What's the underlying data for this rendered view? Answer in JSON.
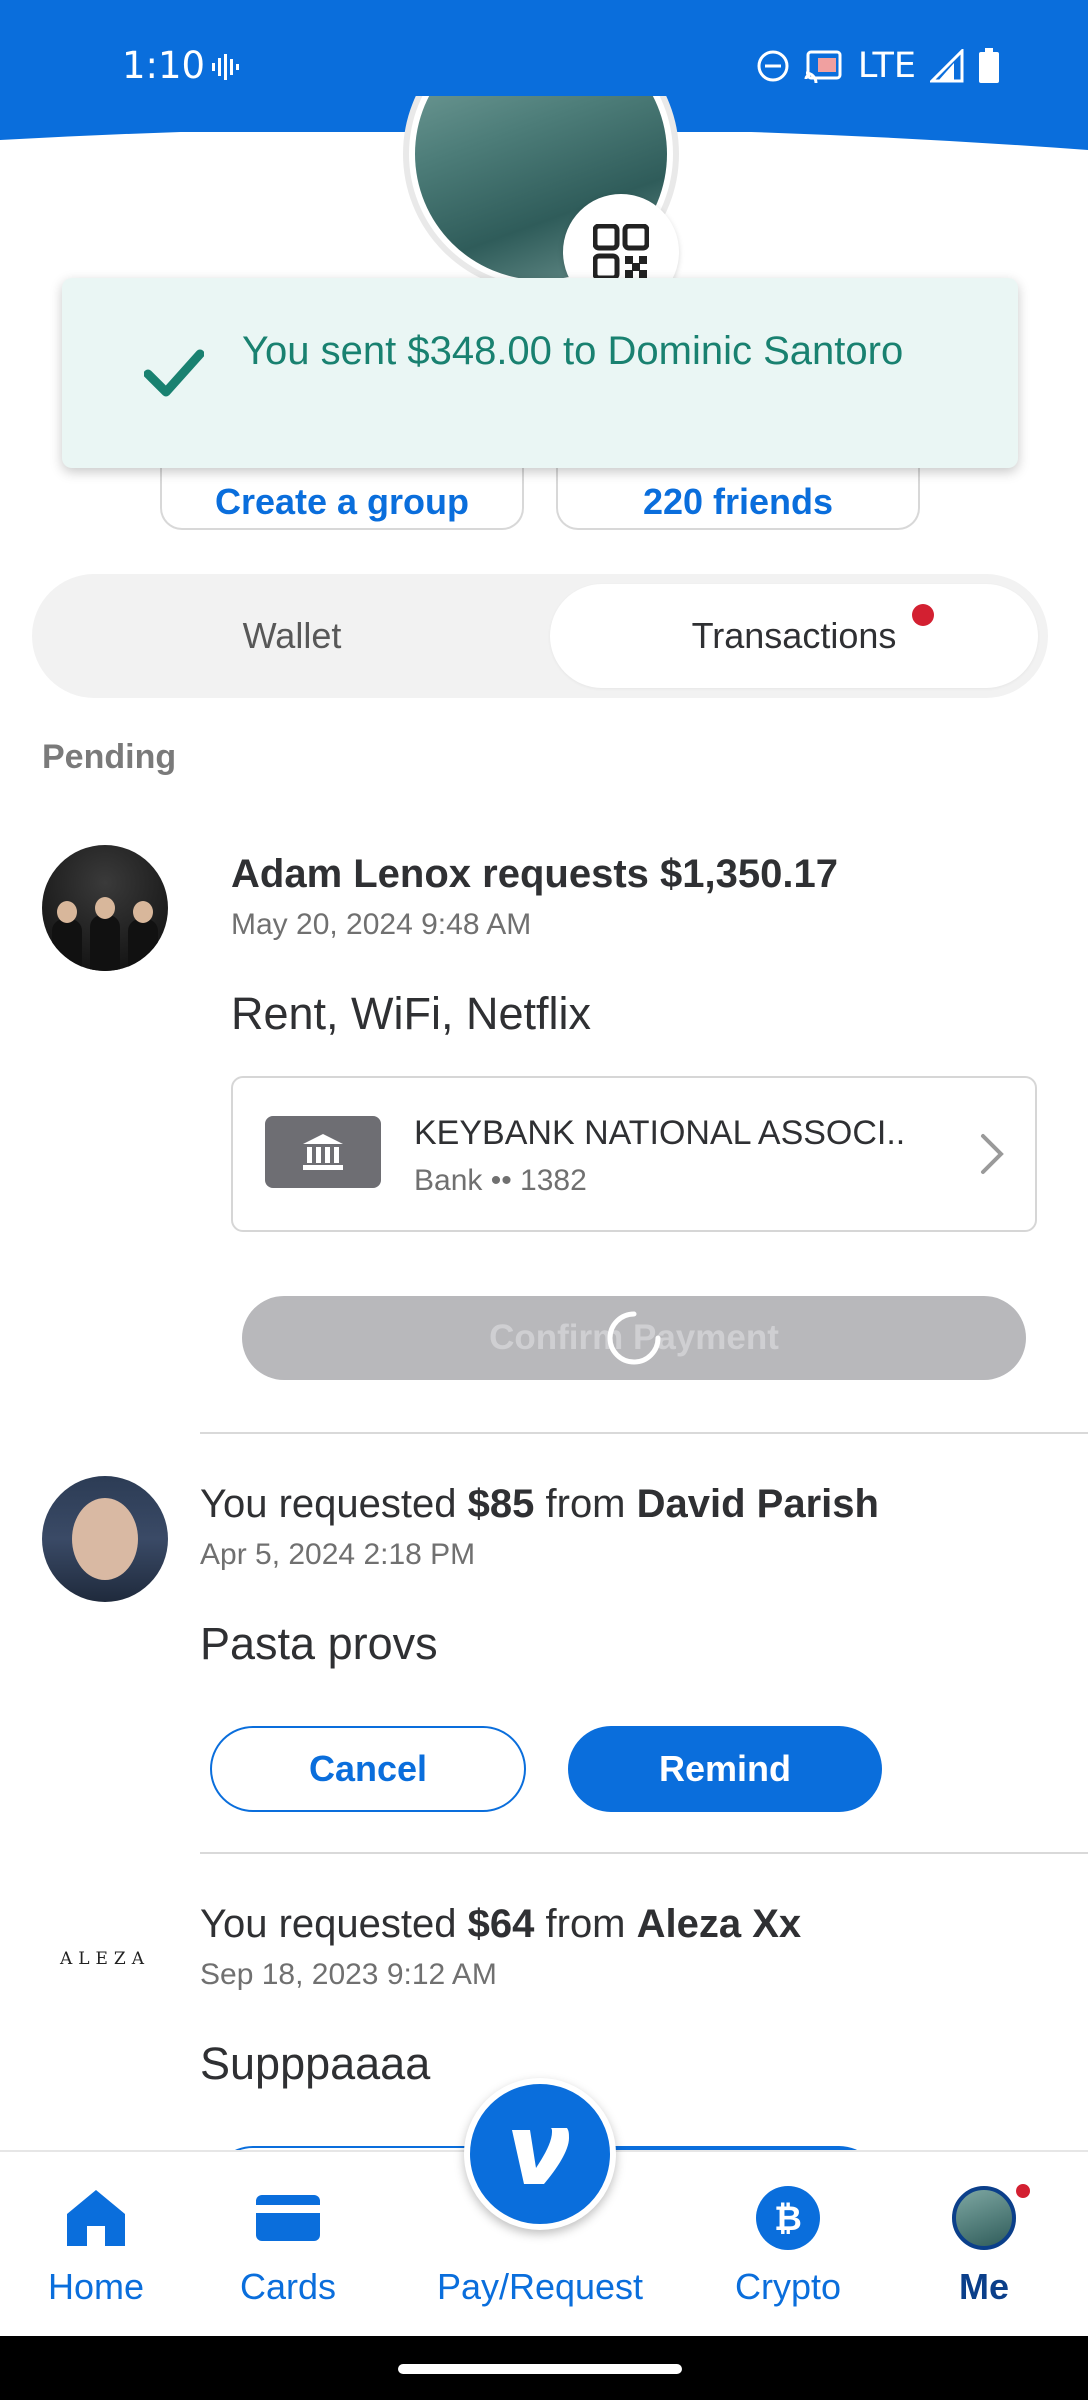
{
  "status_bar": {
    "time": "1:10",
    "network": "LTE"
  },
  "toast": {
    "message": "You sent $348.00 to Dominic Santoro",
    "status_color": "#198170"
  },
  "profile_actions": {
    "create_group": "Create a group",
    "friends": "220 friends"
  },
  "tabs": [
    {
      "label": "Wallet",
      "selected": false
    },
    {
      "label": "Transactions",
      "selected": true,
      "has_notification": true
    }
  ],
  "section": {
    "label": "Pending"
  },
  "transactions": [
    {
      "title": "Adam Lenox requests $1,350.17",
      "date": "May 20, 2024 9:48 AM",
      "note": "Rent, WiFi, Netflix",
      "bank": {
        "name": "KEYBANK NATIONAL ASSOCI..",
        "sub": "Bank •• 1382"
      },
      "action": "Confirm Payment"
    },
    {
      "prefix": "You requested ",
      "amount": "$85",
      "mid": " from ",
      "person": "David Parish",
      "date": "Apr 5, 2024 2:18 PM",
      "note": "Pasta provs",
      "cancel": "Cancel",
      "remind": "Remind"
    },
    {
      "prefix": "You requested ",
      "amount": "$64",
      "mid": " from ",
      "person": "Aleza Xx",
      "avatar_text": "ALEZA",
      "date": "Sep 18, 2023 9:12 AM",
      "note": "Supppaaaa"
    }
  ],
  "bottom_nav": [
    {
      "label": "Home",
      "icon": "home-icon"
    },
    {
      "label": "Cards",
      "icon": "card-icon"
    },
    {
      "label": "Pay/Request",
      "icon": "venmo-v-icon"
    },
    {
      "label": "Crypto",
      "icon": "crypto-icon"
    },
    {
      "label": "Me",
      "icon": "avatar"
    }
  ],
  "colors": {
    "brand_blue": "#0a6edc",
    "notification_red": "#d32031"
  }
}
